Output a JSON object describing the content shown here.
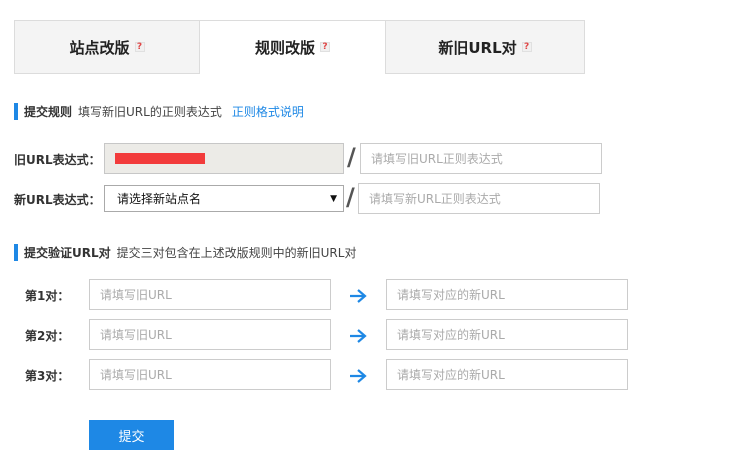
{
  "tabs": [
    {
      "label": "站点改版",
      "help": "?"
    },
    {
      "label": "规则改版",
      "help": "?"
    },
    {
      "label": "新旧URL对",
      "help": "?"
    }
  ],
  "rule_section": {
    "title": "提交规则",
    "desc": "填写新旧URL的正则表达式",
    "link": "正则格式说明"
  },
  "old_rule": {
    "label": "旧URL表达式：",
    "right_placeholder": "请填写旧URL正则表达式"
  },
  "new_rule": {
    "label": "新URL表达式：",
    "select_value": "请选择新站点名",
    "right_placeholder": "请填写新URL正则表达式"
  },
  "slash": "/",
  "verify_section": {
    "title": "提交验证URL对",
    "desc": "提交三对包含在上述改版规则中的新旧URL对"
  },
  "pairs": [
    {
      "label": "第1对：",
      "old_placeholder": "请填写旧URL",
      "new_placeholder": "请填写对应的新URL"
    },
    {
      "label": "第2对：",
      "old_placeholder": "请填写旧URL",
      "new_placeholder": "请填写对应的新URL"
    },
    {
      "label": "第3对：",
      "old_placeholder": "请填写旧URL",
      "new_placeholder": "请填写对应的新URL"
    }
  ],
  "submit_label": "提交",
  "colors": {
    "accent": "#1e88e5",
    "redacted": "#f23b3b"
  }
}
